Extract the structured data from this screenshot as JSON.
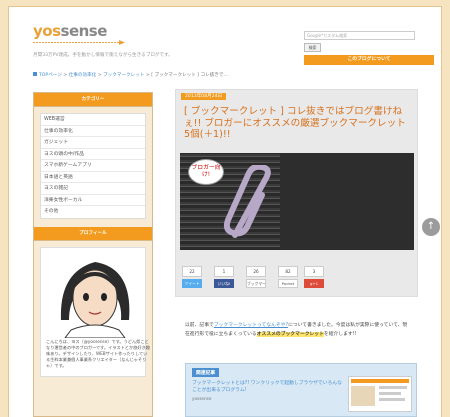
{
  "header": {
    "logo_a": "yos",
    "logo_b": "sense",
    "tagline": "月間33万PV達成。手を動かし情報で衝えながら生きるブログです。",
    "search_placeholder": "Google*カスタム検索",
    "search_button": "検索",
    "about_button": "このブログについて"
  },
  "breadcrumb": {
    "home": "TOPページ",
    "sep": ">",
    "c1": "仕事の効率化",
    "c2": "ブックマークレット",
    "current": "[ ブックマークレット ] コレ抜きで…"
  },
  "sidebar": {
    "categories_title": "カテゴリー",
    "categories": [
      "WEB運営",
      "仕事の効率化",
      "ガジェット",
      "ヨスの頭の中/作品",
      "スマホ新ゲームアプリ",
      "日本語と英語",
      "ヨスの雑記",
      "洋楽女性ボーカル",
      "その他"
    ],
    "profile_title": "プロフィール",
    "profile_text": "こんにちは、ヨス（@yossense）です。うどん県ことなり運営者の中のブロガーです。イラストとか旅好き趣味あり。デザインしたり、WEBサイト作ったりしている生粋本業兼個人事業系クリエイター（なんじゃそりゃ）です。"
  },
  "post": {
    "date": "2013年08月24日",
    "title": "[ ブックマークレット ] コレ抜きではブログ書けねぇ!! ブロガーにオススメの厳選ブックマークレット5個(＋1)!!",
    "bubble_text": "ブロガー向け!"
  },
  "social": [
    {
      "count": "22",
      "label": "ツイート",
      "style": "tw"
    },
    {
      "count": "1",
      "label": "いいね!",
      "style": "fb"
    },
    {
      "count": "26",
      "label": "ブックマーク",
      "style": ""
    },
    {
      "count": "82",
      "label": "Pocket",
      "style": ""
    },
    {
      "count": "3",
      "label": "g+1",
      "style": "gp"
    }
  ],
  "intro": {
    "t1": "以前、記事で",
    "link": "ブックマークレットってなんぞや?",
    "t2": "について書きました。今度は私が実際に使っていて、現在進行形で役に立ちまくっている",
    "hl": "オススメのブックマークレット",
    "t3": "を紹介します!!"
  },
  "related": {
    "title": "関連記事",
    "link": "ブックマークレットとは?! ワンクリックで起動しブラウザでいろんなことが出来るプログラム!",
    "source": "yossense"
  }
}
